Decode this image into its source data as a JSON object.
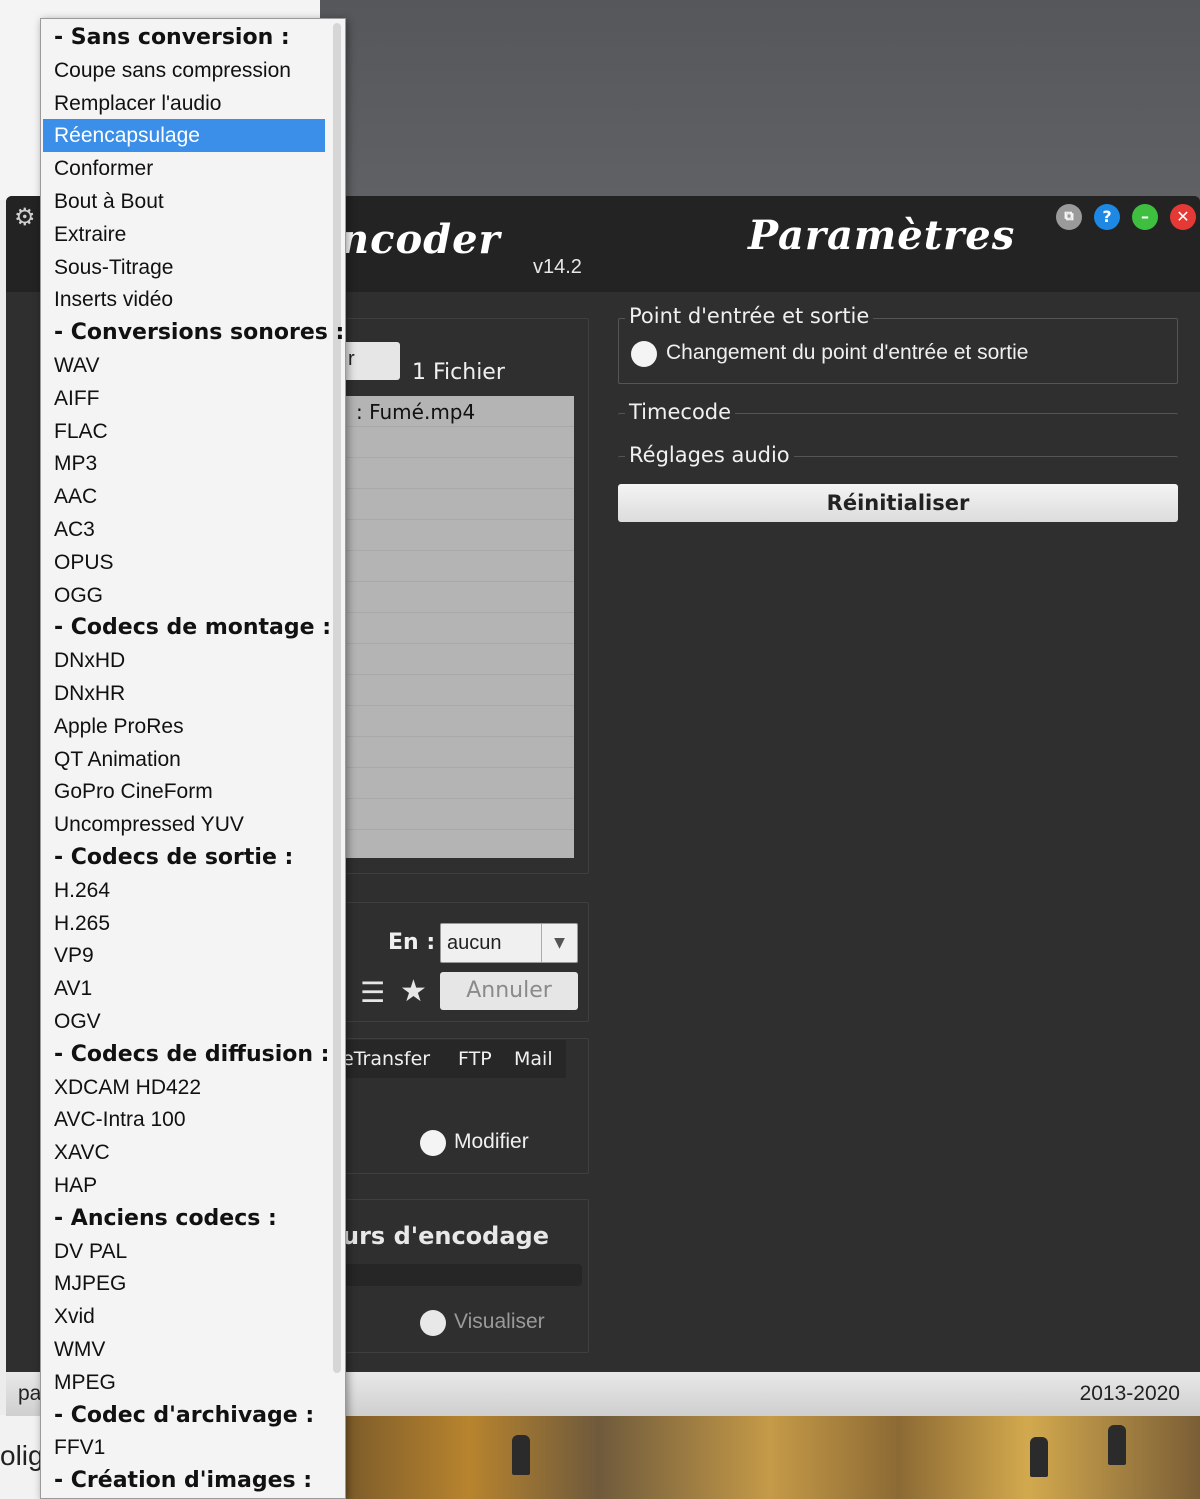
{
  "app": {
    "name_fragment": "ncoder",
    "version": "v14.2",
    "params_title": "Paramètres",
    "footer_left": "pa",
    "footer_right": "2013-2020"
  },
  "window_controls": {
    "help_label": "?",
    "minimize_label": "–",
    "close_label": "✕",
    "extra_label": "⧉"
  },
  "files": {
    "button_label": "r",
    "count": "1 Fichier",
    "items": [
      ": Fumé.mp4"
    ]
  },
  "encode": {
    "en_label": "En :",
    "select_value": "aucun",
    "cancel_label": "Annuler"
  },
  "share": {
    "tabs": [
      "eTransfer",
      "FTP",
      "Mail"
    ],
    "modify_label": "Modifier"
  },
  "preview": {
    "title": "urs d'encodage",
    "visualize_label": "Visualiser"
  },
  "parameters": {
    "io_group_title": "Point d'entrée et sortie",
    "io_option_label": "Changement du point d'entrée et sortie",
    "timecode_title": "Timecode",
    "audio_title": "Réglages audio",
    "reset_label": "Réinitialiser"
  },
  "background": {
    "bottom_left_text": "olige"
  },
  "menu": {
    "items": [
      {
        "label": "- Sans conversion :",
        "header": true
      },
      {
        "label": "Coupe sans compression"
      },
      {
        "label": "Remplacer l'audio"
      },
      {
        "label": "Réencapsulage",
        "selected": true
      },
      {
        "label": "Conformer"
      },
      {
        "label": "Bout à Bout"
      },
      {
        "label": "Extraire"
      },
      {
        "label": "Sous-Titrage"
      },
      {
        "label": "Inserts vidéo"
      },
      {
        "label": "- Conversions sonores :",
        "header": true
      },
      {
        "label": "WAV"
      },
      {
        "label": "AIFF"
      },
      {
        "label": "FLAC"
      },
      {
        "label": "MP3"
      },
      {
        "label": "AAC"
      },
      {
        "label": "AC3"
      },
      {
        "label": "OPUS"
      },
      {
        "label": "OGG"
      },
      {
        "label": "- Codecs de montage :",
        "header": true
      },
      {
        "label": "DNxHD"
      },
      {
        "label": "DNxHR"
      },
      {
        "label": "Apple ProRes"
      },
      {
        "label": "QT Animation"
      },
      {
        "label": "GoPro CineForm"
      },
      {
        "label": "Uncompressed YUV"
      },
      {
        "label": "- Codecs de sortie :",
        "header": true
      },
      {
        "label": "H.264"
      },
      {
        "label": "H.265"
      },
      {
        "label": "VP9"
      },
      {
        "label": "AV1"
      },
      {
        "label": "OGV"
      },
      {
        "label": "- Codecs de diffusion :",
        "header": true
      },
      {
        "label": "XDCAM HD422"
      },
      {
        "label": "AVC-Intra 100"
      },
      {
        "label": "XAVC"
      },
      {
        "label": "HAP"
      },
      {
        "label": "- Anciens codecs :",
        "header": true
      },
      {
        "label": "DV PAL"
      },
      {
        "label": "MJPEG"
      },
      {
        "label": "Xvid"
      },
      {
        "label": "WMV"
      },
      {
        "label": "MPEG"
      },
      {
        "label": "- Codec d'archivage :",
        "header": true
      },
      {
        "label": "FFV1"
      },
      {
        "label": "- Création d'images :",
        "header": true
      }
    ]
  },
  "colors": {
    "selection": "#3c8fe8",
    "window_bg": "#2f2f2f",
    "header_bg": "#232323",
    "close_red": "#e53935",
    "help_blue": "#1e88e5",
    "minimize_green": "#3fbf3f"
  }
}
